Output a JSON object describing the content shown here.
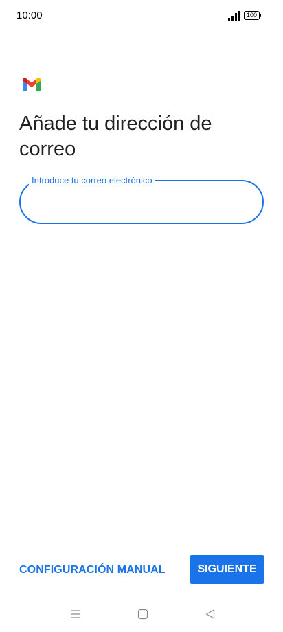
{
  "status_bar": {
    "time": "10:00",
    "battery_level": "100",
    "icons": [
      "signal-icon",
      "battery-icon"
    ]
  },
  "app": {
    "logo": "gmail-logo-icon"
  },
  "page": {
    "title": "Añade tu dirección de correo"
  },
  "email_field": {
    "label": "Introduce tu correo electrónico",
    "value": "",
    "placeholder": ""
  },
  "actions": {
    "manual_label": "CONFIGURACIÓN MANUAL",
    "next_label": "SIGUIENTE"
  },
  "nav_bar": {
    "icons": [
      "menu-icon",
      "home-icon",
      "back-icon"
    ]
  },
  "colors": {
    "accent": "#1a73e8",
    "text": "#202124",
    "background": "#ffffff"
  }
}
